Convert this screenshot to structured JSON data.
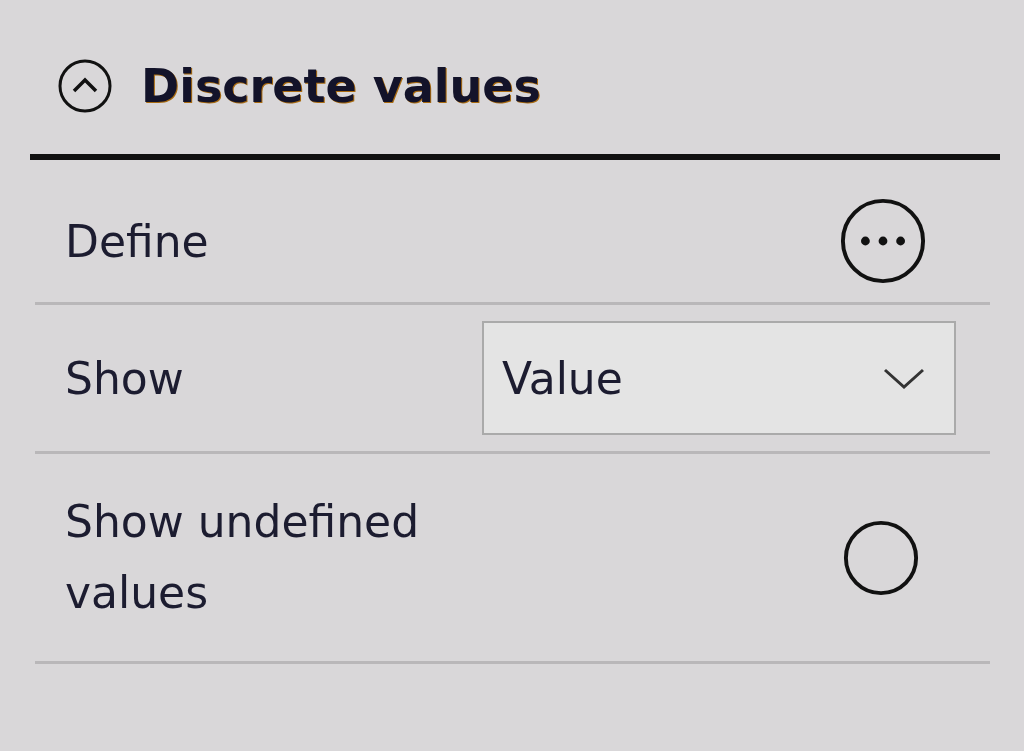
{
  "section": {
    "title": "Discrete values",
    "expanded": true
  },
  "rows": [
    {
      "kind": "button",
      "label": "Define"
    },
    {
      "kind": "dropdown",
      "label": "Show",
      "value": "Value"
    },
    {
      "kind": "radio",
      "label": "Show undefined values",
      "checked": false
    }
  ]
}
